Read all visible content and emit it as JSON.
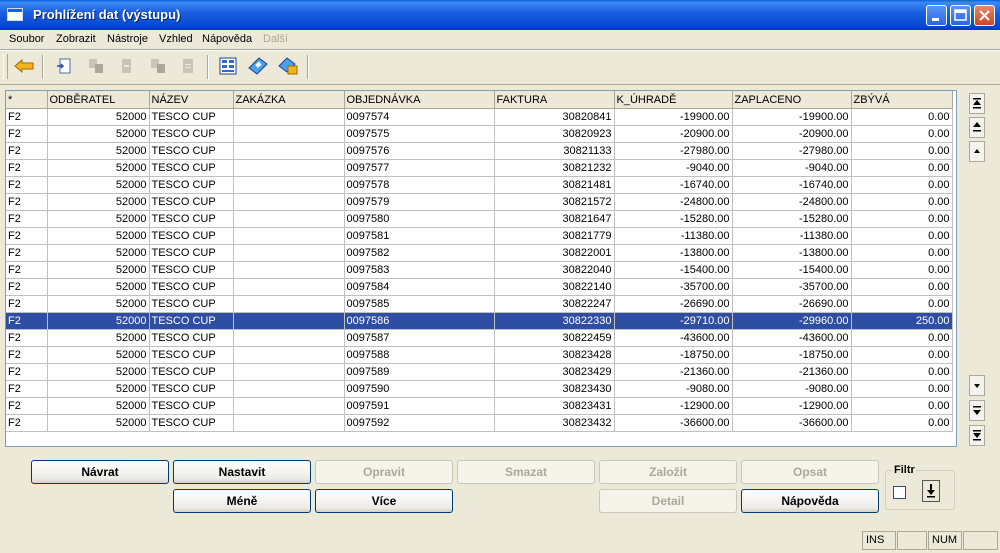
{
  "window": {
    "title": "Prohlížení dat (výstupu)"
  },
  "menu": [
    "Soubor",
    "Zobrazit",
    "Nástroje",
    "Vzhled",
    "Nápověda",
    "Další"
  ],
  "toolbar": {
    "icons": [
      "back-icon",
      "new-record-icon",
      "copy-record-icon",
      "delete-record-icon",
      "copy-down-icon",
      "document-icon",
      "export-icon",
      "calculator-icon",
      "calendar-icon"
    ]
  },
  "table": {
    "columns": [
      "*",
      "ODBĚRATEL",
      "NÁZEV",
      "ZAKÁZKA",
      "OBJEDNÁVKA",
      "FAKTURA",
      "K_ÚHRADĚ",
      "ZAPLACENO",
      "ZBÝVÁ"
    ],
    "selected_row": 12,
    "rows": [
      [
        "F2",
        "52000",
        "TESCO CUP",
        "",
        "0097574",
        "30820841",
        "-19900.00",
        "-19900.00",
        "0.00"
      ],
      [
        "F2",
        "52000",
        "TESCO CUP",
        "",
        "0097575",
        "30820923",
        "-20900.00",
        "-20900.00",
        "0.00"
      ],
      [
        "F2",
        "52000",
        "TESCO CUP",
        "",
        "0097576",
        "30821133",
        "-27980.00",
        "-27980.00",
        "0.00"
      ],
      [
        "F2",
        "52000",
        "TESCO CUP",
        "",
        "0097577",
        "30821232",
        "-9040.00",
        "-9040.00",
        "0.00"
      ],
      [
        "F2",
        "52000",
        "TESCO CUP",
        "",
        "0097578",
        "30821481",
        "-16740.00",
        "-16740.00",
        "0.00"
      ],
      [
        "F2",
        "52000",
        "TESCO CUP",
        "",
        "0097579",
        "30821572",
        "-24800.00",
        "-24800.00",
        "0.00"
      ],
      [
        "F2",
        "52000",
        "TESCO CUP",
        "",
        "0097580",
        "30821647",
        "-15280.00",
        "-15280.00",
        "0.00"
      ],
      [
        "F2",
        "52000",
        "TESCO CUP",
        "",
        "0097581",
        "30821779",
        "-11380.00",
        "-11380.00",
        "0.00"
      ],
      [
        "F2",
        "52000",
        "TESCO CUP",
        "",
        "0097582",
        "30822001",
        "-13800.00",
        "-13800.00",
        "0.00"
      ],
      [
        "F2",
        "52000",
        "TESCO CUP",
        "",
        "0097583",
        "30822040",
        "-15400.00",
        "-15400.00",
        "0.00"
      ],
      [
        "F2",
        "52000",
        "TESCO CUP",
        "",
        "0097584",
        "30822140",
        "-35700.00",
        "-35700.00",
        "0.00"
      ],
      [
        "F2",
        "52000",
        "TESCO CUP",
        "",
        "0097585",
        "30822247",
        "-26690.00",
        "-26690.00",
        "0.00"
      ],
      [
        "F2",
        "52000",
        "TESCO CUP",
        "",
        "0097586",
        "30822330",
        "-29710.00",
        "-29960.00",
        "250.00"
      ],
      [
        "F2",
        "52000",
        "TESCO CUP",
        "",
        "0097587",
        "30822459",
        "-43600.00",
        "-43600.00",
        "0.00"
      ],
      [
        "F2",
        "52000",
        "TESCO CUP",
        "",
        "0097588",
        "30823428",
        "-18750.00",
        "-18750.00",
        "0.00"
      ],
      [
        "F2",
        "52000",
        "TESCO CUP",
        "",
        "0097589",
        "30823429",
        "-21360.00",
        "-21360.00",
        "0.00"
      ],
      [
        "F2",
        "52000",
        "TESCO CUP",
        "",
        "0097590",
        "30823430",
        "-9080.00",
        "-9080.00",
        "0.00"
      ],
      [
        "F2",
        "52000",
        "TESCO CUP",
        "",
        "0097591",
        "30823431",
        "-12900.00",
        "-12900.00",
        "0.00"
      ],
      [
        "F2",
        "52000",
        "TESCO CUP",
        "",
        "0097592",
        "30823432",
        "-36600.00",
        "-36600.00",
        "0.00"
      ]
    ]
  },
  "buttons": {
    "navrat": "Návrat",
    "nastavit": "Nastavit",
    "opravit": "Opravit",
    "smazat": "Smazat",
    "zalozit": "Založit",
    "opsat": "Opsat",
    "mene": "Méně",
    "vice": "Více",
    "detail": "Detail",
    "napoveda": "Nápověda"
  },
  "filter": {
    "label": "Filtr",
    "checked": false
  },
  "status": {
    "ins": "INS",
    "num": "NUM"
  },
  "colors": {
    "selection": "#2e4ea1",
    "titlebar": "#0548cf"
  }
}
